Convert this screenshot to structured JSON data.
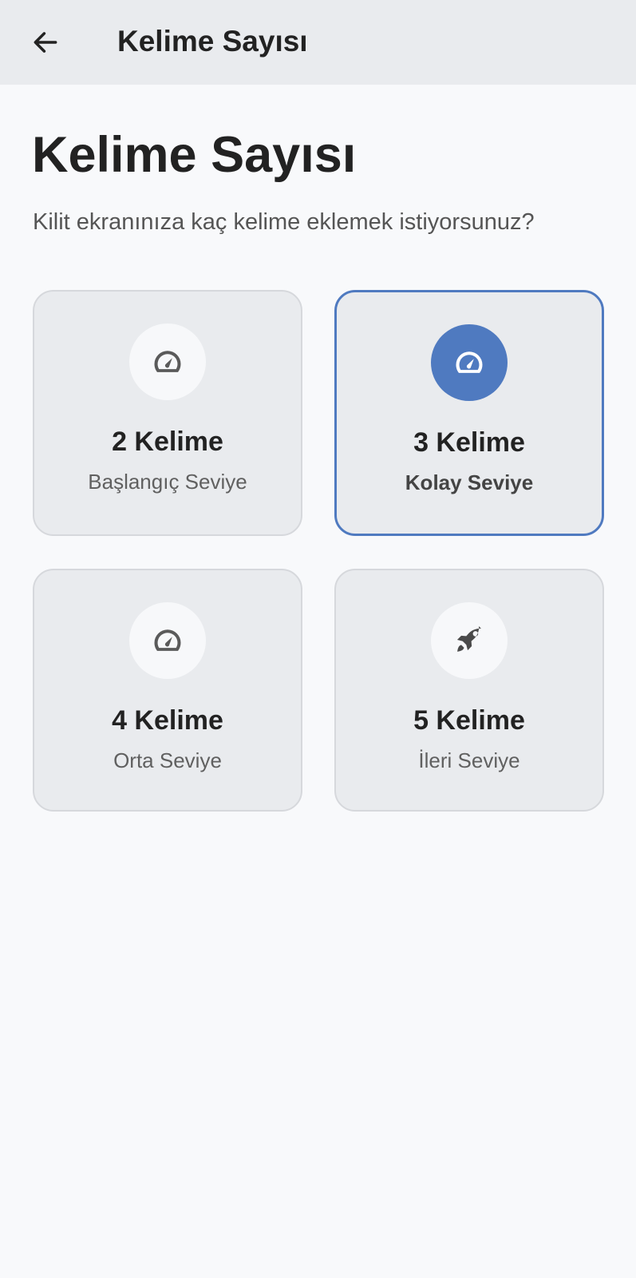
{
  "appbar": {
    "back_icon": "arrow-left-icon",
    "title": "Kelime Sayısı"
  },
  "page": {
    "title": "Kelime Sayısı",
    "subtitle": "Kilit ekranınıza kaç kelime eklemek istiyorsunuz?"
  },
  "options": [
    {
      "title": "2 Kelime",
      "subtitle": "Başlangıç Seviye",
      "icon": "speedometer-icon",
      "selected": false
    },
    {
      "title": "3 Kelime",
      "subtitle": "Kolay Seviye",
      "icon": "speedometer-icon",
      "selected": true
    },
    {
      "title": "4 Kelime",
      "subtitle": "Orta Seviye",
      "icon": "speedometer-icon",
      "selected": false
    },
    {
      "title": "5 Kelime",
      "subtitle": "İleri Seviye",
      "icon": "rocket-icon",
      "selected": false
    }
  ],
  "colors": {
    "accent": "#4f7ac0",
    "appbar_bg": "#e9ebee",
    "page_bg": "#f8f9fb",
    "card_bg": "#e9ebee"
  }
}
